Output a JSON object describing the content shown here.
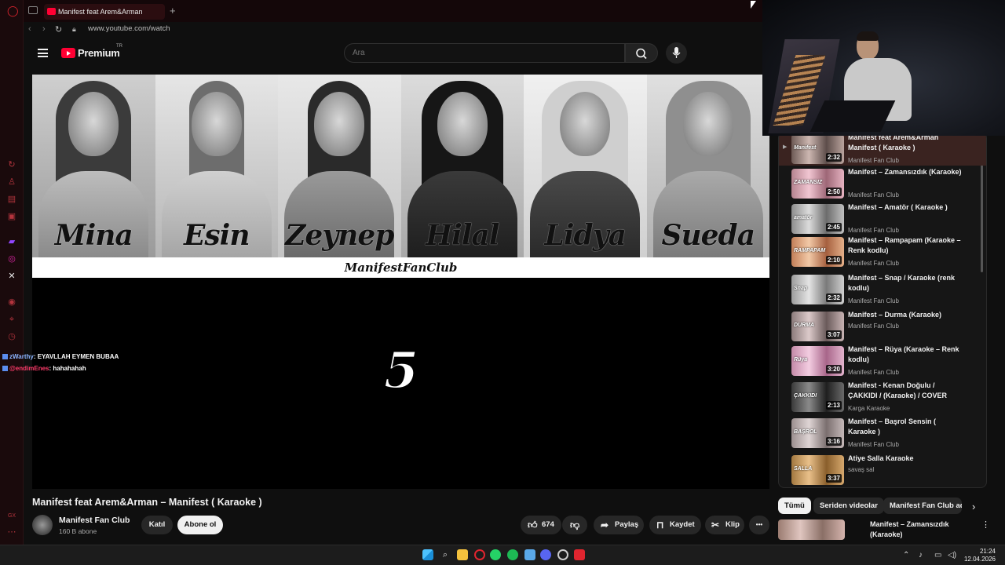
{
  "browser": {
    "tab_title": "Manifest feat Arem&Arman",
    "add_tab": "+",
    "url": "www.youtube.com/watch"
  },
  "youtube": {
    "logo_text": "Premium",
    "logo_region": "TR",
    "search_placeholder": "Ara"
  },
  "video": {
    "banner_names": [
      "Mina",
      "Esin",
      "Zeynep",
      "Hilal",
      "Lidya",
      "Sueda"
    ],
    "fanclub_text": "ManifestFanClub",
    "countdown": "5",
    "title": "Manifest feat Arem&Arman – Manifest ( Karaoke )"
  },
  "chat": [
    {
      "user": "zWarthy",
      "message": ": EYAVLLAH EYMEN BUBAA"
    },
    {
      "user": "@endimEnes",
      "message": ": hahahahah"
    }
  ],
  "channel": {
    "name": "Manifest Fan Club",
    "subscribers": "160 B abone",
    "join_label": "Katıl",
    "subscribe_label": "Abone ol"
  },
  "actions": {
    "likes": "674",
    "share_label": "Paylaş",
    "save_label": "Kaydet",
    "clip_label": "Klip",
    "more_label": "•••"
  },
  "playlist": [
    {
      "title": "Manifest feat Arem&Arman Manifest ( Karaoke )",
      "channel": "Manifest Fan Club",
      "duration": "2:32",
      "thumb_label": "Manifest",
      "active": true
    },
    {
      "title": "Manifest – Zamansızdık (Karaoke)",
      "channel": "Manifest Fan Club",
      "duration": "2:50",
      "thumb_label": "ZAMANSIZ",
      "active": false
    },
    {
      "title": "Manifest – Amatör ( Karaoke )",
      "channel": "Manifest Fan Club",
      "duration": "2:45",
      "thumb_label": "amatör",
      "active": false
    },
    {
      "title": "Manifest – Rampapam (Karaoke – Renk kodlu)",
      "channel": "Manifest Fan Club",
      "duration": "2:10",
      "thumb_label": "RAMPAPAM",
      "active": false
    },
    {
      "title": "Manifest – Snap / Karaoke (renk kodlu)",
      "channel": "Manifest Fan Club",
      "duration": "2:32",
      "thumb_label": "Snap",
      "active": false
    },
    {
      "title": "Manifest – Durma (Karaoke)",
      "channel": "Manifest Fan Club",
      "duration": "3:07",
      "thumb_label": "DURMA",
      "active": false
    },
    {
      "title": "Manifest – Rüya (Karaoke – Renk kodlu)",
      "channel": "Manifest Fan Club",
      "duration": "3:20",
      "thumb_label": "Rüya",
      "active": false
    },
    {
      "title": "Manifest - Kenan Doğulu / ÇAKKIDI / (Karaoke) / COVER",
      "channel": "Karga Karaoke",
      "duration": "2:13",
      "thumb_label": "ÇAKKIDI",
      "active": false
    },
    {
      "title": "Manifest – Başrol Sensin ( Karaoke )",
      "channel": "Manifest Fan Club",
      "duration": "3:16",
      "thumb_label": "BAŞROL",
      "active": false
    },
    {
      "title": "Atiye Salla Karaoke",
      "channel": "savaş sal",
      "duration": "3:37",
      "thumb_label": "SALLA",
      "active": false
    }
  ],
  "chips": [
    "Tümü",
    "Seriden videolar",
    "Manifest Fan Club adı"
  ],
  "recommendation": {
    "title": "Manifest – Zamansızdık (Karaoke)"
  },
  "taskbar": {
    "time": "21:24",
    "date": "12.04.2026"
  },
  "colors": {
    "accent_red": "#ff0033",
    "opera_red": "#b3343d"
  }
}
